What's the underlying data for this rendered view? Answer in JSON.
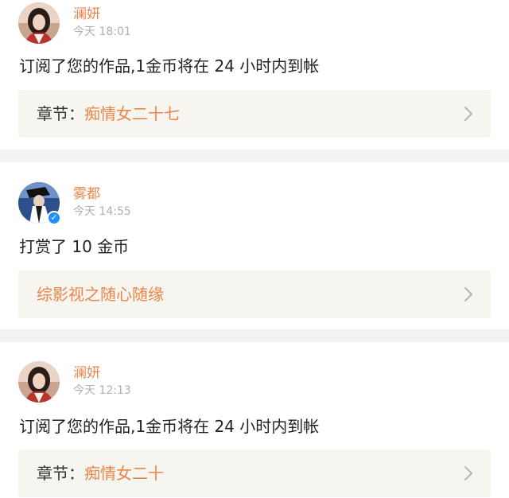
{
  "theme": {
    "accent": "#e8864b",
    "text": "#222222",
    "muted": "#b0b0b0",
    "link_bg": "#f7f5ef",
    "page_bg": "#f2f2f2",
    "verified": "#1e90ff"
  },
  "notifications": [
    {
      "avatar_icon": "user-avatar-icon",
      "username": "澜妍",
      "time": "今天 18:01",
      "message": "订阅了您的作品,1金币将在 24 小时内到帐",
      "link_prefix": "章节：",
      "link_title": "痴情女二十七",
      "chevron_icon": "chevron-right-icon"
    },
    {
      "avatar_icon": "user-avatar-icon",
      "verified_icon": "verified-badge-icon",
      "verified_mark": "✓",
      "username": "雾都",
      "time": "今天 14:55",
      "message": "打赏了 10 金币",
      "link_prefix": "",
      "link_title": "综影视之随心随缘",
      "chevron_icon": "chevron-right-icon"
    },
    {
      "avatar_icon": "user-avatar-icon",
      "username": "澜妍",
      "time": "今天 12:13",
      "message": "订阅了您的作品,1金币将在 24 小时内到帐",
      "link_prefix": "章节：",
      "link_title": "痴情女二十",
      "chevron_icon": "chevron-right-icon"
    }
  ]
}
